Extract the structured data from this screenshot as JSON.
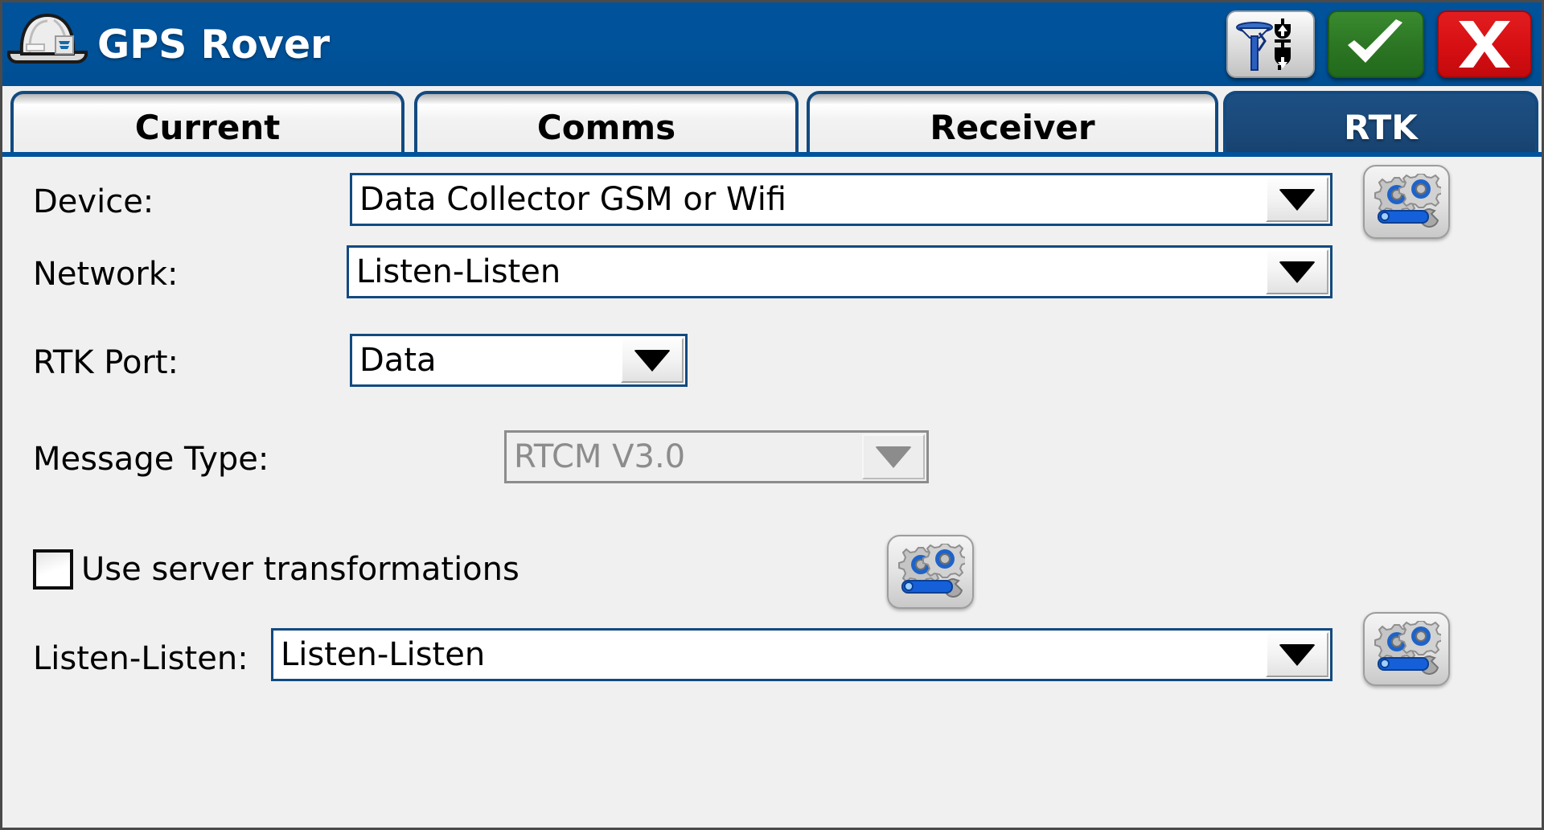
{
  "window": {
    "title": "GPS Rover",
    "logo_icon": "hard-hat-icon",
    "header_color": "#00529b"
  },
  "titlebar_buttons": [
    {
      "name": "antenna-height-button",
      "icon": "gps-antenna-height-icon",
      "label": ""
    },
    {
      "name": "ok-button",
      "icon": "checkmark-icon",
      "label": "",
      "color": "#2b7523"
    },
    {
      "name": "cancel-button",
      "icon": "x-icon",
      "label": "X",
      "color": "#d60f12"
    }
  ],
  "tabs": [
    {
      "label": "Current",
      "active": false
    },
    {
      "label": "Comms",
      "active": false
    },
    {
      "label": "Receiver",
      "active": false
    },
    {
      "label": "RTK",
      "active": true
    }
  ],
  "form": {
    "device": {
      "label": "Device:",
      "value": "Data Collector GSM or Wifi",
      "config_icon": "gears-wrench-icon"
    },
    "network": {
      "label": "Network:",
      "value": "Listen-Listen"
    },
    "rtk_port": {
      "label": "RTK Port:",
      "value": "Data"
    },
    "message_type": {
      "label": "Message Type:",
      "value": "RTCM V3.0",
      "disabled": true
    },
    "use_server_transformations": {
      "label": "Use server transformations",
      "checked": false,
      "config_icon": "gears-wrench-icon"
    },
    "listen_listen": {
      "label": "Listen-Listen:",
      "value": "Listen-Listen",
      "config_icon": "gears-wrench-icon"
    }
  },
  "colors": {
    "accent_blue": "#00529b",
    "tab_border": "#124a80",
    "active_tab": "#1a4878",
    "field_border": "#124a80",
    "disabled_gray": "#8c8c8c",
    "page_bg": "#f0f0f0"
  }
}
